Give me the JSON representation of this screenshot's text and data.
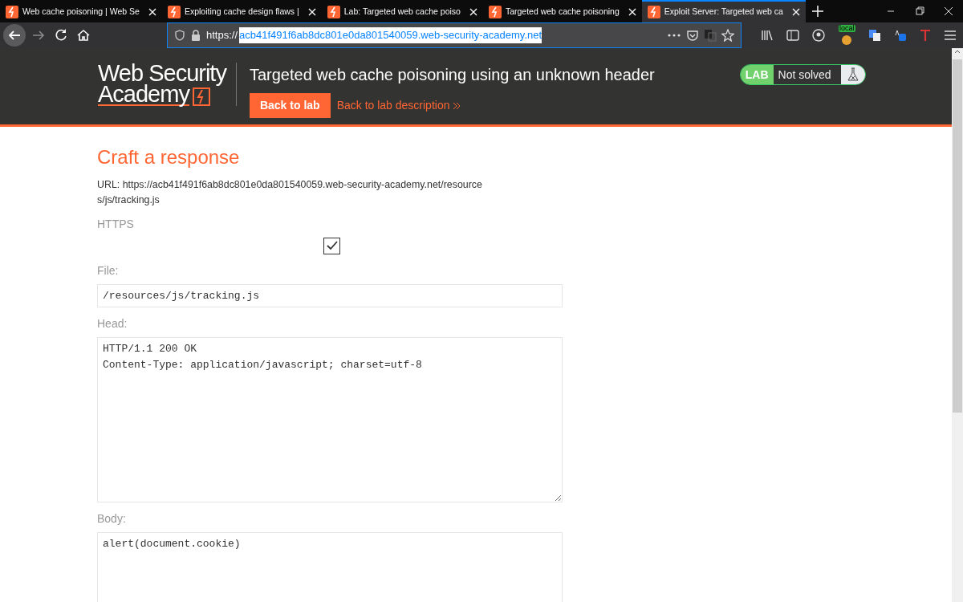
{
  "browser": {
    "tabs": [
      {
        "title": "Web cache poisoning | Web Se",
        "selected": false
      },
      {
        "title": "Exploiting cache design flaws |",
        "selected": false
      },
      {
        "title": "Lab: Targeted web cache poiso",
        "selected": false
      },
      {
        "title": "Targeted web cache poisoning",
        "selected": false
      },
      {
        "title": "Exploit Server: Targeted web ca",
        "selected": true
      }
    ],
    "address": {
      "scheme": "https://",
      "host": "acb41f491f6ab8dc801e0da801540059.web-security-academy.net"
    },
    "extension_badge": "local"
  },
  "header": {
    "logo": {
      "line1": "Web Security",
      "line2": "Academy"
    },
    "title": "Targeted web cache poisoning using an unknown header",
    "back_button": "Back to lab",
    "description_link": "Back to lab description",
    "lab_status": {
      "label": "LAB",
      "status": "Not solved",
      "solved": false
    }
  },
  "form": {
    "heading": "Craft a response",
    "url_text": "URL: https://acb41f491f6ab8dc801e0da801540059.web-security-academy.net/resources/js/tracking.js",
    "fields": [
      {
        "label": "HTTPS",
        "kind": "checkbox",
        "checked": true
      },
      {
        "label": "File:",
        "kind": "input",
        "value": "/resources/js/tracking.js"
      },
      {
        "label": "Head:",
        "kind": "textarea",
        "value": "HTTP/1.1 200 OK\nContent-Type: application/javascript; charset=utf-8"
      },
      {
        "label": "Body:",
        "kind": "textarea",
        "value": "alert(document.cookie)"
      }
    ]
  }
}
